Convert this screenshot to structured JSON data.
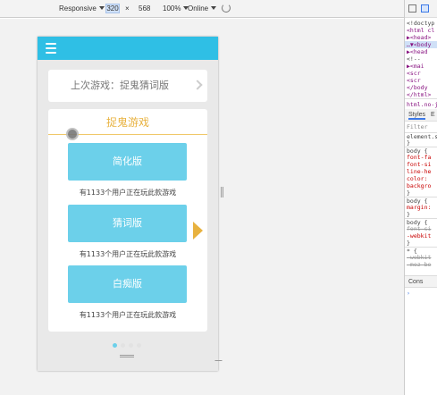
{
  "toolbar": {
    "device": "Responsive",
    "width": "320",
    "separator": "×",
    "height": "568",
    "zoom": "100%",
    "network": "Online"
  },
  "app": {
    "last_game_label": "上次游戏：捉鬼猜词版",
    "section_title": "捉鬼游戏",
    "modes": [
      {
        "label": "简化版",
        "caption": "有1133个用户正在玩此款游戏"
      },
      {
        "label": "猜词版",
        "caption": "有1133个用户正在玩此款游戏"
      },
      {
        "label": "白痴版",
        "caption": "有1133个用户正在玩此款游戏"
      }
    ],
    "pager_active": 0,
    "colors": {
      "header": "#2fbfe5",
      "button": "#6cd0ea",
      "accent": "#e8b23f"
    }
  },
  "devtools": {
    "dom_lines": [
      "<!doctyp",
      "<html cl",
      "▶<head>",
      "…▼<body",
      "▶<head",
      "<!--",
      "▶<mai",
      "<scr",
      "<scr",
      "</body",
      "</html>"
    ],
    "breadcrumb": "html.no-js",
    "tabs": [
      "Styles",
      "E"
    ],
    "filter": "Filter",
    "source": "element.s",
    "rules": [
      "}",
      "body {",
      "font-fa",
      "font-si",
      "line-he",
      "color:",
      "backgro",
      "}",
      "body {",
      "margin:",
      "}",
      "body {",
      "font-si",
      "-webkit",
      "}",
      "* {",
      "-webkit",
      "-moz-bo"
    ],
    "console_tab": "Cons"
  }
}
